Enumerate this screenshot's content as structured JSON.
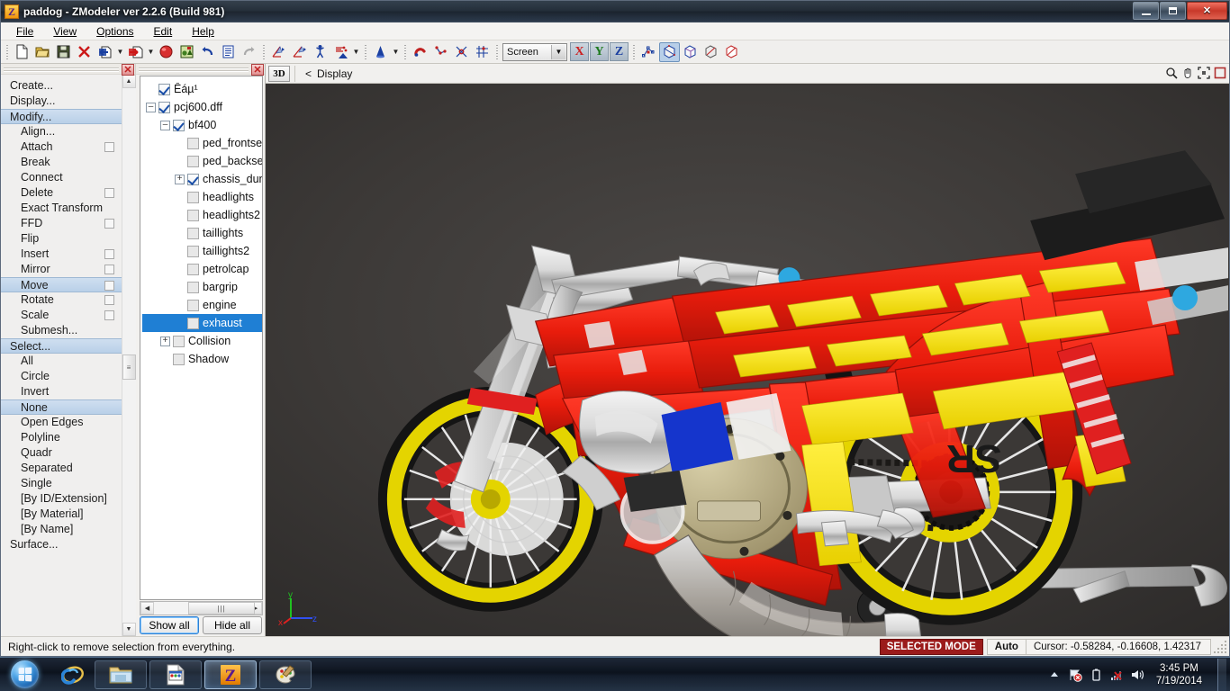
{
  "window": {
    "title": "paddog - ZModeler ver 2.2.6 (Build 981)",
    "app_icon": "Z",
    "minimize_label": "Minimize",
    "maximize_label": "Restore",
    "close_label": "✕"
  },
  "menubar": {
    "items": [
      {
        "label": "File",
        "accel": "F"
      },
      {
        "label": "View",
        "accel": "V"
      },
      {
        "label": "Options",
        "accel": "O"
      },
      {
        "label": "Edit",
        "accel": "E"
      },
      {
        "label": "Help",
        "accel": "H"
      }
    ]
  },
  "toolbar": {
    "groups": [
      {
        "buttons": [
          {
            "icon": "new-document-icon",
            "label": "New"
          },
          {
            "icon": "open-folder-icon",
            "label": "Open"
          },
          {
            "icon": "save-floppy-icon",
            "label": "Save"
          },
          {
            "icon": "delete-x-icon",
            "label": "Delete"
          },
          {
            "icon": "import-icon",
            "label": "Import",
            "dropdown": true
          },
          {
            "icon": "export-icon",
            "label": "Export",
            "dropdown": true
          },
          {
            "icon": "render-sphere-icon",
            "label": "Render"
          },
          {
            "icon": "material-editor-icon",
            "label": "Material Editor"
          },
          {
            "icon": "undo-icon",
            "label": "Undo"
          },
          {
            "icon": "properties-icon",
            "label": "Properties"
          },
          {
            "icon": "redo-icon",
            "label": "Redo"
          }
        ]
      },
      {
        "buttons": [
          {
            "icon": "vertex-mode-icon",
            "label": "Vertices"
          },
          {
            "icon": "face-mode-icon",
            "label": "Faces"
          },
          {
            "icon": "object-mode-icon",
            "label": "Objects"
          },
          {
            "icon": "poly-mode-icon",
            "label": "Polygons",
            "dropdown": true
          }
        ]
      },
      {
        "buttons": [
          {
            "icon": "cone-primitive-icon",
            "label": "Create Primitive",
            "dropdown": true
          }
        ]
      },
      {
        "buttons": [
          {
            "icon": "magnet-snap-icon",
            "label": "Snap"
          },
          {
            "icon": "vertex-snap-icon",
            "label": "Vertex Snap"
          },
          {
            "icon": "edge-snap-icon",
            "label": "Edge Snap"
          },
          {
            "icon": "grid-snap-icon",
            "label": "Grid Snap"
          }
        ]
      }
    ],
    "coordsys": {
      "value": "Screen",
      "icon": "chevron-down-icon"
    },
    "axes": [
      {
        "label": "X",
        "color": "#cc2020",
        "active": false
      },
      {
        "label": "Y",
        "color": "#1d7a1d",
        "active": false
      },
      {
        "label": "Z",
        "color": "#1a3fa0",
        "active": false
      }
    ],
    "view_buttons": [
      {
        "icon": "pivot-icon",
        "label": "Pivot"
      },
      {
        "icon": "cube-shaded-icon",
        "label": "Shaded",
        "active": true
      },
      {
        "icon": "cube-wire-icon",
        "label": "Wireframe"
      },
      {
        "icon": "cube-flat-icon",
        "label": "Flat"
      },
      {
        "icon": "cube-outline-icon",
        "label": "Outline"
      }
    ]
  },
  "cmdpanel": {
    "close_label": "✕",
    "items": [
      {
        "label": "Create...",
        "level": 0,
        "selected": false,
        "checkbox": false
      },
      {
        "label": "Display...",
        "level": 0,
        "selected": false,
        "checkbox": false
      },
      {
        "label": "Modify...",
        "level": 0,
        "selected": true,
        "checkbox": false
      },
      {
        "label": "Align...",
        "level": 1,
        "selected": false,
        "checkbox": false
      },
      {
        "label": "Attach",
        "level": 1,
        "selected": false,
        "checkbox": true
      },
      {
        "label": "Break",
        "level": 1,
        "selected": false,
        "checkbox": false
      },
      {
        "label": "Connect",
        "level": 1,
        "selected": false,
        "checkbox": false
      },
      {
        "label": "Delete",
        "level": 1,
        "selected": false,
        "checkbox": true
      },
      {
        "label": "Exact Transform",
        "level": 1,
        "selected": false,
        "checkbox": false
      },
      {
        "label": "FFD",
        "level": 1,
        "selected": false,
        "checkbox": true
      },
      {
        "label": "Flip",
        "level": 1,
        "selected": false,
        "checkbox": false
      },
      {
        "label": "Insert",
        "level": 1,
        "selected": false,
        "checkbox": true
      },
      {
        "label": "Mirror",
        "level": 1,
        "selected": false,
        "checkbox": true
      },
      {
        "label": "Move",
        "level": 1,
        "selected": true,
        "checkbox": true
      },
      {
        "label": "Rotate",
        "level": 1,
        "selected": false,
        "checkbox": true
      },
      {
        "label": "Scale",
        "level": 1,
        "selected": false,
        "checkbox": true
      },
      {
        "label": "Submesh...",
        "level": 1,
        "selected": false,
        "checkbox": false
      },
      {
        "label": "Select...",
        "level": 0,
        "selected": true,
        "checkbox": false
      },
      {
        "label": "All",
        "level": 1,
        "selected": false,
        "checkbox": false
      },
      {
        "label": "Circle",
        "level": 1,
        "selected": false,
        "checkbox": false
      },
      {
        "label": "Invert",
        "level": 1,
        "selected": false,
        "checkbox": false
      },
      {
        "label": "None",
        "level": 1,
        "selected": true,
        "checkbox": false
      },
      {
        "label": "Open Edges",
        "level": 1,
        "selected": false,
        "checkbox": false
      },
      {
        "label": "Polyline",
        "level": 1,
        "selected": false,
        "checkbox": false
      },
      {
        "label": "Quadr",
        "level": 1,
        "selected": false,
        "checkbox": false
      },
      {
        "label": "Separated",
        "level": 1,
        "selected": false,
        "checkbox": false
      },
      {
        "label": "Single",
        "level": 1,
        "selected": false,
        "checkbox": false
      },
      {
        "label": "[By ID/Extension]",
        "level": 1,
        "selected": false,
        "checkbox": false
      },
      {
        "label": "[By Material]",
        "level": 1,
        "selected": false,
        "checkbox": false
      },
      {
        "label": "[By Name]",
        "level": 1,
        "selected": false,
        "checkbox": false
      },
      {
        "label": "Surface...",
        "level": 0,
        "selected": false,
        "checkbox": false
      }
    ]
  },
  "treepanel": {
    "close_label": "✕",
    "nodes": [
      {
        "label": "Êáµ¹",
        "level": 0,
        "expander": "none",
        "checked": true,
        "selected": false
      },
      {
        "label": "pcj600.dff",
        "level": 0,
        "expander": "minus",
        "checked": true,
        "selected": false
      },
      {
        "label": "bf400",
        "level": 1,
        "expander": "minus",
        "checked": true,
        "selected": false
      },
      {
        "label": "ped_frontseat",
        "level": 2,
        "expander": "none",
        "checked": false,
        "selected": false
      },
      {
        "label": "ped_backseat",
        "level": 2,
        "expander": "none",
        "checked": false,
        "selected": false
      },
      {
        "label": "chassis_dummy",
        "level": 2,
        "expander": "plus",
        "checked": true,
        "selected": false
      },
      {
        "label": "headlights",
        "level": 2,
        "expander": "none",
        "checked": false,
        "selected": false
      },
      {
        "label": "headlights2",
        "level": 2,
        "expander": "none",
        "checked": false,
        "selected": false
      },
      {
        "label": "taillights",
        "level": 2,
        "expander": "none",
        "checked": false,
        "selected": false
      },
      {
        "label": "taillights2",
        "level": 2,
        "expander": "none",
        "checked": false,
        "selected": false
      },
      {
        "label": "petrolcap",
        "level": 2,
        "expander": "none",
        "checked": false,
        "selected": false
      },
      {
        "label": "bargrip",
        "level": 2,
        "expander": "none",
        "checked": false,
        "selected": false
      },
      {
        "label": "engine",
        "level": 2,
        "expander": "none",
        "checked": false,
        "selected": false
      },
      {
        "label": "exhaust",
        "level": 2,
        "expander": "none",
        "checked": false,
        "selected": true
      },
      {
        "label": "Collision",
        "level": 1,
        "expander": "plus",
        "checked": false,
        "selected": false
      },
      {
        "label": "Shadow",
        "level": 1,
        "expander": "none",
        "checked": false,
        "selected": false
      }
    ],
    "buttons": {
      "show_all": "Show all",
      "hide_all": "Hide all"
    },
    "scroll_left_icon": "chevron-left-icon",
    "scroll_right_icon": "chevron-right-icon"
  },
  "viewport": {
    "mode_button": "3D",
    "back_arrow": "<",
    "view_label": "Display",
    "tools": [
      {
        "icon": "zoom-magnifier-icon",
        "label": "Zoom"
      },
      {
        "icon": "pan-hand-icon",
        "label": "Pan"
      },
      {
        "icon": "zoom-extents-icon",
        "label": "Zoom extents"
      },
      {
        "icon": "maximize-view-icon",
        "label": "Maximize viewport"
      }
    ],
    "axis_gizmo": {
      "x": "x",
      "y": "y",
      "z": "z",
      "x_color": "#e02020",
      "y_color": "#20c020",
      "z_color": "#3050f0"
    },
    "scene_description": "Shaded 3D view of a drag-style motorcycle model with red and yellow frame, yellow spoked wheels, chrome exhaust and a rear paddock stand",
    "background_color": "#3d3a38"
  },
  "statusbar": {
    "hint": "Right-click to remove selection from everything.",
    "selected_mode": "SELECTED MODE",
    "auto": "Auto",
    "cursor": "Cursor: -0.58284, -0.16608, 1.42317"
  },
  "taskbar": {
    "start_label": "Start",
    "buttons": [
      {
        "icon": "internet-explorer-icon",
        "label": "Internet Explorer",
        "active": false,
        "pinned": true
      },
      {
        "icon": "windows-explorer-icon",
        "label": "Windows Explorer",
        "active": false
      },
      {
        "icon": "document-window-icon",
        "label": "Document",
        "active": false
      },
      {
        "icon": "zmodeler-icon",
        "label": "ZModeler",
        "active": true
      },
      {
        "icon": "paint-palette-icon",
        "label": "Paint",
        "active": false
      }
    ],
    "tray": [
      {
        "icon": "show-hidden-icons-arrow",
        "label": "Show hidden icons"
      },
      {
        "icon": "action-center-flag-icon",
        "label": "Action Center"
      },
      {
        "icon": "battery-icon",
        "label": "Battery"
      },
      {
        "icon": "network-disconnected-icon",
        "label": "Network"
      },
      {
        "icon": "volume-speaker-icon",
        "label": "Volume"
      }
    ],
    "clock": {
      "time": "3:45 PM",
      "date": "7/19/2014"
    },
    "show_desktop_label": "Show desktop"
  }
}
